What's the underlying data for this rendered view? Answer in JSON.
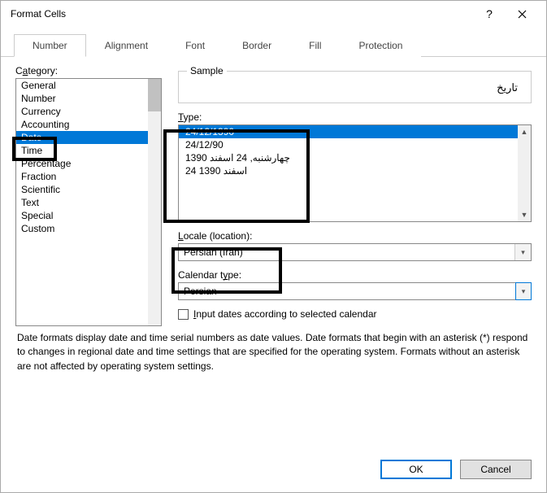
{
  "window": {
    "title": "Format Cells"
  },
  "tabs": {
    "items": [
      "Number",
      "Alignment",
      "Font",
      "Border",
      "Fill",
      "Protection"
    ],
    "active_index": 0
  },
  "category": {
    "label_pre": "C",
    "label_u": "a",
    "label_post": "tegory:",
    "items": [
      "General",
      "Number",
      "Currency",
      "Accounting",
      "Date",
      "Time",
      "Percentage",
      "Fraction",
      "Scientific",
      "Text",
      "Special",
      "Custom"
    ],
    "selected_index": 4
  },
  "sample": {
    "legend": "Sample",
    "value": "تاريخ"
  },
  "type": {
    "label_u": "T",
    "label_post": "ype:",
    "items": [
      "24/12/1390",
      "24/12/90",
      "چهارشنبه, 24 اسفند 1390",
      "24 اسفند 1390"
    ],
    "selected_index": 0
  },
  "locale": {
    "label_u": "L",
    "label_post": "ocale (location):",
    "value": "Persian (Iran)"
  },
  "calendar": {
    "label_pre": "Calendar t",
    "label_u": "y",
    "label_post": "pe:",
    "value": "Persian"
  },
  "input_dates": {
    "label_u": "I",
    "label_post": "nput dates according to selected calendar",
    "checked": false
  },
  "description": "Date formats display date and time serial numbers as date values.  Date formats that begin with an asterisk (*) respond to changes in regional date and time settings that are specified for the operating system. Formats without an asterisk are not affected by operating system settings.",
  "buttons": {
    "ok": "OK",
    "cancel": "Cancel"
  }
}
